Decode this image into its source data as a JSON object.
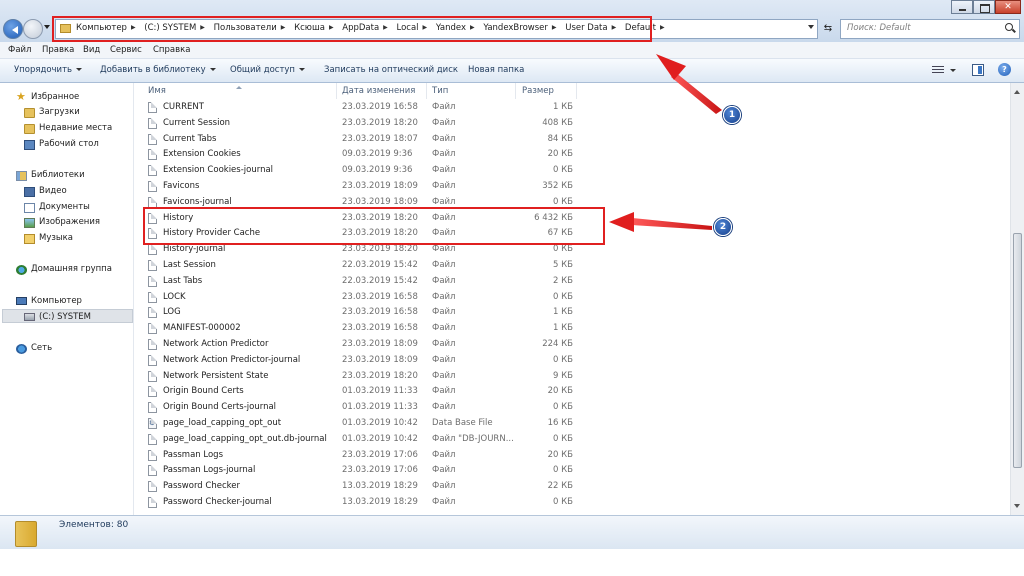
{
  "address": {
    "crumbs": [
      "Компьютер",
      "(C:) SYSTEM",
      "Пользователи",
      "Ксюша",
      "AppData",
      "Local",
      "Yandex",
      "YandexBrowser",
      "User Data",
      "Default"
    ],
    "search_placeholder": "Поиск: Default"
  },
  "menu": [
    "Файл",
    "Правка",
    "Вид",
    "Сервис",
    "Справка"
  ],
  "toolbar": {
    "organize": "Упорядочить",
    "add_library": "Добавить в библиотеку",
    "share": "Общий доступ",
    "burn": "Записать на оптический диск",
    "new_folder": "Новая папка"
  },
  "nav": {
    "favorites": "Избранное",
    "downloads": "Загрузки",
    "recent": "Недавние места",
    "desktop": "Рабочий стол",
    "libraries": "Библиотеки",
    "video": "Видео",
    "documents": "Документы",
    "images": "Изображения",
    "music": "Музыка",
    "homegroup": "Домашняя группа",
    "computer": "Компьютер",
    "drive": "(C:) SYSTEM",
    "network": "Сеть"
  },
  "columns": {
    "name": "Имя",
    "date": "Дата изменения",
    "type": "Тип",
    "size": "Размер"
  },
  "files": [
    {
      "name": "CURRENT",
      "date": "23.03.2019 16:58",
      "type": "Файл",
      "size": "1 КБ"
    },
    {
      "name": "Current Session",
      "date": "23.03.2019 18:20",
      "type": "Файл",
      "size": "408 КБ"
    },
    {
      "name": "Current Tabs",
      "date": "23.03.2019 18:07",
      "type": "Файл",
      "size": "84 КБ"
    },
    {
      "name": "Extension Cookies",
      "date": "09.03.2019 9:36",
      "type": "Файл",
      "size": "20 КБ"
    },
    {
      "name": "Extension Cookies-journal",
      "date": "09.03.2019 9:36",
      "type": "Файл",
      "size": "0 КБ"
    },
    {
      "name": "Favicons",
      "date": "23.03.2019 18:09",
      "type": "Файл",
      "size": "352 КБ"
    },
    {
      "name": "Favicons-journal",
      "date": "23.03.2019 18:09",
      "type": "Файл",
      "size": "0 КБ"
    },
    {
      "name": "History",
      "date": "23.03.2019 18:20",
      "type": "Файл",
      "size": "6 432 КБ"
    },
    {
      "name": "History Provider Cache",
      "date": "23.03.2019 18:20",
      "type": "Файл",
      "size": "67 КБ"
    },
    {
      "name": "History-journal",
      "date": "23.03.2019 18:20",
      "type": "Файл",
      "size": "0 КБ"
    },
    {
      "name": "Last Session",
      "date": "22.03.2019 15:42",
      "type": "Файл",
      "size": "5 КБ"
    },
    {
      "name": "Last Tabs",
      "date": "22.03.2019 15:42",
      "type": "Файл",
      "size": "2 КБ"
    },
    {
      "name": "LOCK",
      "date": "23.03.2019 16:58",
      "type": "Файл",
      "size": "0 КБ"
    },
    {
      "name": "LOG",
      "date": "23.03.2019 16:58",
      "type": "Файл",
      "size": "1 КБ"
    },
    {
      "name": "MANIFEST-000002",
      "date": "23.03.2019 16:58",
      "type": "Файл",
      "size": "1 КБ"
    },
    {
      "name": "Network Action Predictor",
      "date": "23.03.2019 18:09",
      "type": "Файл",
      "size": "224 КБ"
    },
    {
      "name": "Network Action Predictor-journal",
      "date": "23.03.2019 18:09",
      "type": "Файл",
      "size": "0 КБ"
    },
    {
      "name": "Network Persistent State",
      "date": "23.03.2019 18:20",
      "type": "Файл",
      "size": "9 КБ"
    },
    {
      "name": "Origin Bound Certs",
      "date": "01.03.2019 11:33",
      "type": "Файл",
      "size": "20 КБ"
    },
    {
      "name": "Origin Bound Certs-journal",
      "date": "01.03.2019 11:33",
      "type": "Файл",
      "size": "0 КБ"
    },
    {
      "name": "page_load_capping_opt_out",
      "date": "01.03.2019 10:42",
      "type": "Data Base File",
      "size": "16 КБ"
    },
    {
      "name": "page_load_capping_opt_out.db-journal",
      "date": "01.03.2019 10:42",
      "type": "Файл \"DB-JOURN...",
      "size": "0 КБ"
    },
    {
      "name": "Passman Logs",
      "date": "23.03.2019 17:06",
      "type": "Файл",
      "size": "20 КБ"
    },
    {
      "name": "Passman Logs-journal",
      "date": "23.03.2019 17:06",
      "type": "Файл",
      "size": "0 КБ"
    },
    {
      "name": "Password Checker",
      "date": "13.03.2019 18:29",
      "type": "Файл",
      "size": "22 КБ"
    },
    {
      "name": "Password Checker-journal",
      "date": "13.03.2019 18:29",
      "type": "Файл",
      "size": "0 КБ"
    }
  ],
  "status": "Элементов: 80",
  "markers": [
    "1",
    "2"
  ],
  "colors": {
    "annotation": "#e02020",
    "marker": "#1f4fa0"
  }
}
